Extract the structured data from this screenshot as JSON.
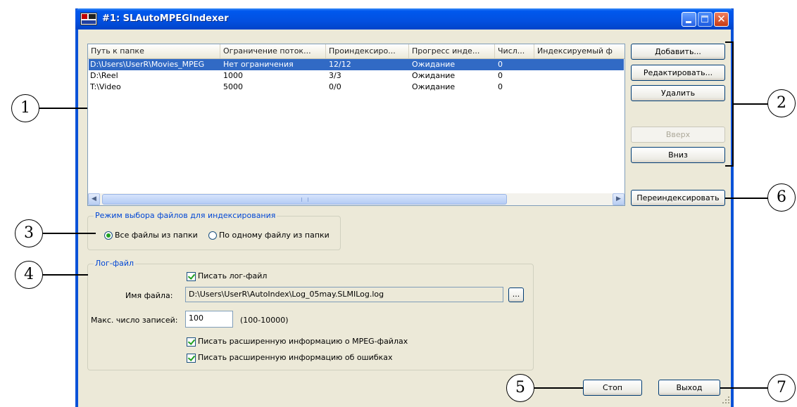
{
  "window": {
    "title": "#1: SLAutoMPEGIndexer"
  },
  "list": {
    "columns": [
      "Путь к папке",
      "Ограничение поток...",
      "Проиндексиро...",
      "Прогресс инде...",
      "Числ...",
      "Индексируемый ф"
    ],
    "rows": [
      [
        "D:\\Users\\UserR\\Movies_MPEG",
        "Нет ограничения",
        "12/12",
        "Ожидание",
        "0",
        ""
      ],
      [
        "D:\\Reel",
        "1000",
        "3/3",
        "Ожидание",
        "0",
        ""
      ],
      [
        "T:\\Video",
        "5000",
        "0/0",
        "Ожидание",
        "0",
        ""
      ]
    ],
    "selected_row": 0
  },
  "buttons": {
    "add": "Добавить...",
    "edit": "Редактировать...",
    "delete": "Удалить",
    "up": "Вверх",
    "down": "Вниз",
    "reindex": "Переиндексировать",
    "stop": "Стоп",
    "exit": "Выход",
    "browse": "..."
  },
  "mode_group": {
    "legend": "Режим выбора файлов для индексирования",
    "option_all": "Все файлы из папки",
    "option_one": "По одному файлу из папки",
    "selected": "all"
  },
  "log_group": {
    "legend": "Лог-файл",
    "write_log": "Писать лог-файл",
    "write_log_checked": true,
    "filename_label": "Имя файла:",
    "filename_value": "D:\\Users\\UserR\\AutoIndex\\Log_05may.SLMILog.log",
    "max_label": "Макс. число записей:",
    "max_value": "100",
    "max_range": "(100-10000)",
    "mpeg_info": "Писать расширенную информацию о MPEG-файлах",
    "mpeg_info_checked": true,
    "error_info": "Писать расширенную информацию об ошибках",
    "error_info_checked": true
  },
  "callouts": [
    "1",
    "2",
    "3",
    "4",
    "5",
    "6",
    "7"
  ],
  "colors": {
    "titlebar": "#0058ee",
    "selection": "#316ac5",
    "group_legend": "#0046d5",
    "checkmark": "#21a121"
  }
}
